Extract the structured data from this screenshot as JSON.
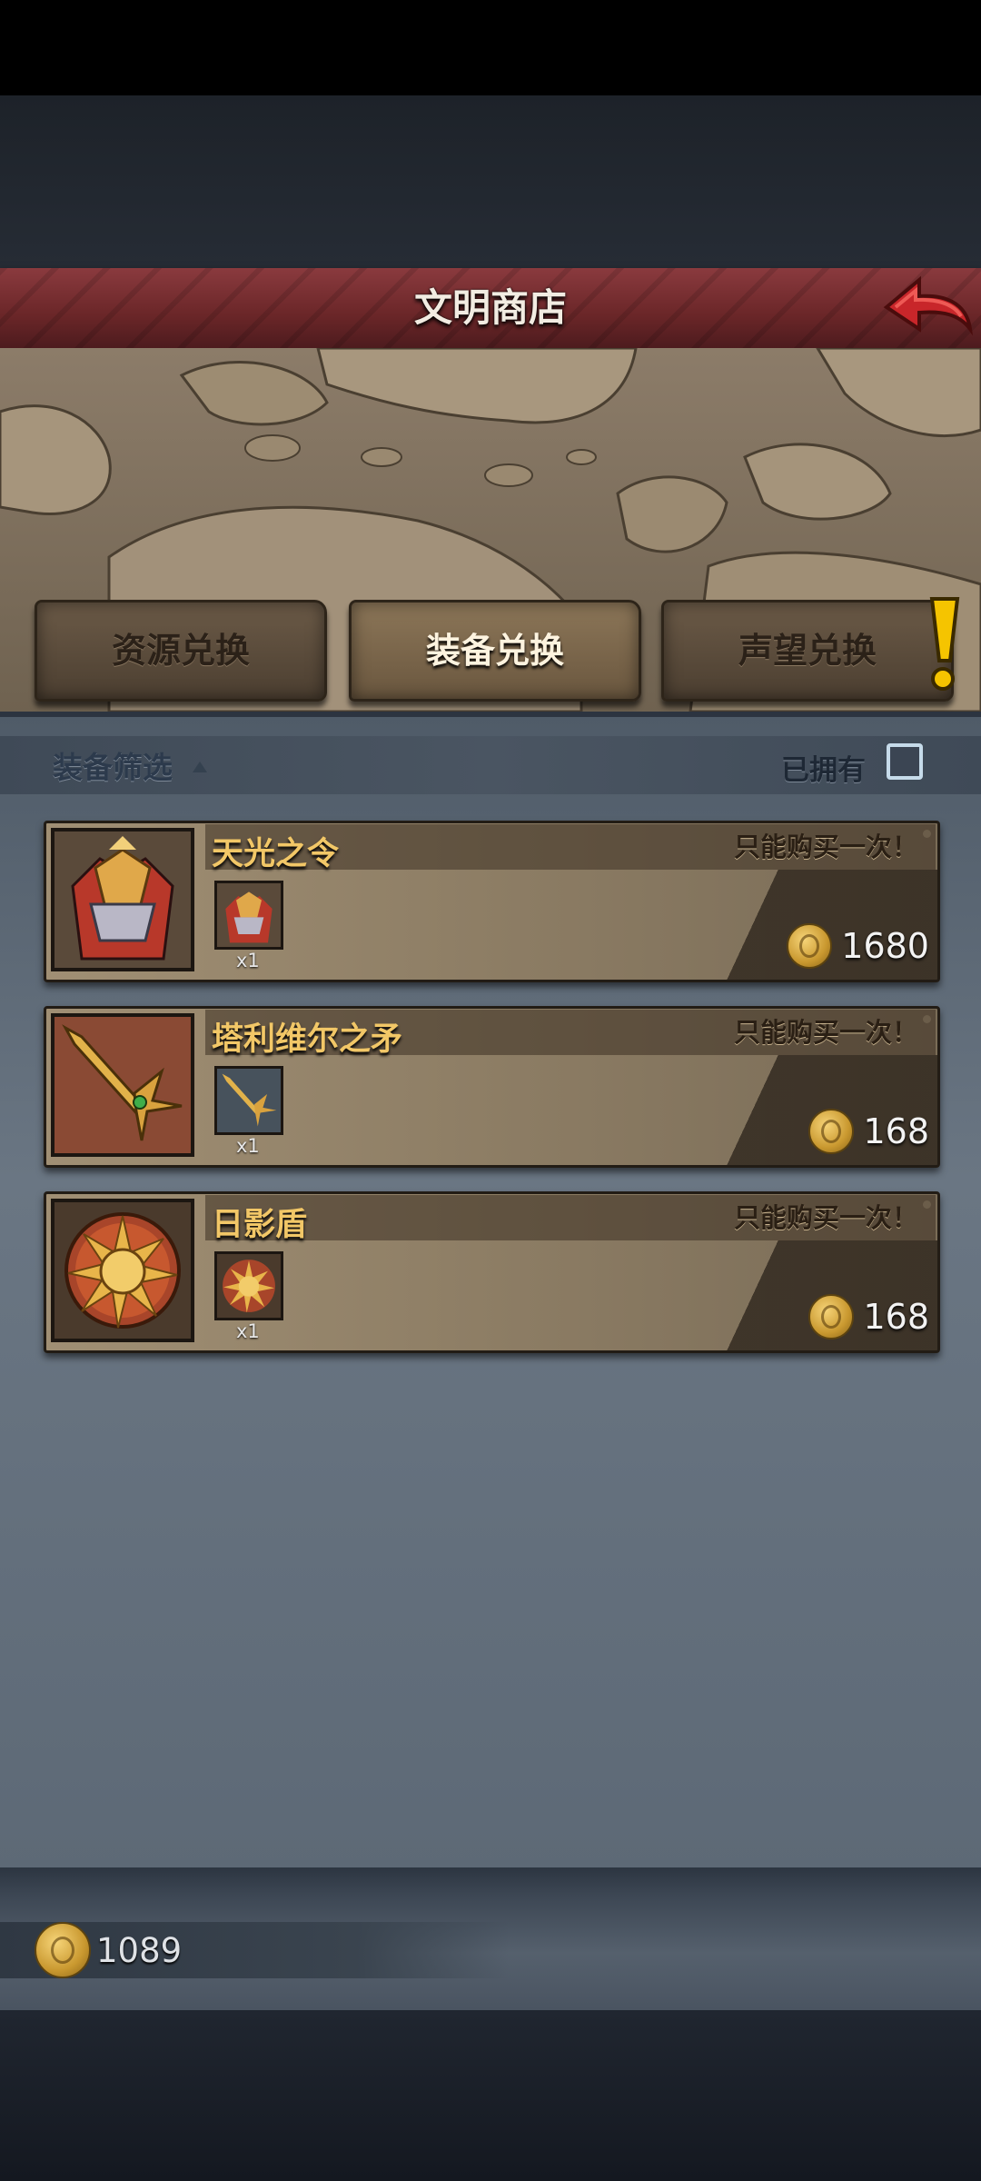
{
  "header": {
    "title": "文明商店"
  },
  "tabs": [
    {
      "label": "资源兑换",
      "active": false
    },
    {
      "label": "装备兑换",
      "active": true
    },
    {
      "label": "声望兑换",
      "active": false,
      "alert": true
    }
  ],
  "filter": {
    "label": "装备筛选",
    "owned_label": "已拥有",
    "owned_checked": false
  },
  "items": [
    {
      "name": "天光之令",
      "limit": "只能购买一次！",
      "quantity": "x1",
      "price": "1680",
      "icon": "armor-icon"
    },
    {
      "name": "塔利维尔之矛",
      "limit": "只能购买一次！",
      "quantity": "x1",
      "price": "168",
      "icon": "spear-icon"
    },
    {
      "name": "日影盾",
      "limit": "只能购买一次！",
      "quantity": "x1",
      "price": "168",
      "icon": "sun-shield-icon"
    }
  ],
  "balance": {
    "value": "1089",
    "icon": "coin-icon"
  },
  "colors": {
    "accent_gold": "#f2c767",
    "header_red": "#6a2628",
    "alert_yellow": "#f5c400"
  }
}
